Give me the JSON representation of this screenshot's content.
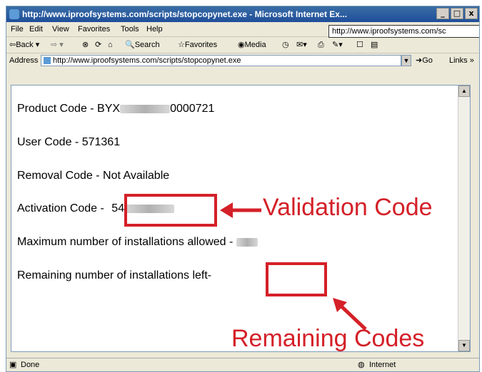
{
  "window": {
    "title": "http://www.iproofsystems.com/scripts/stopcopynet.exe - Microsoft Internet Ex...",
    "minimize": "_",
    "maximize": "□",
    "close": "x"
  },
  "menu": [
    "File",
    "Edit",
    "View",
    "Favorites",
    "Tools",
    "Help"
  ],
  "tooltip_url": "http://www.iproofsystems.com/sc",
  "toolbar": {
    "back": "⇦Back ▾",
    "forward": "⇨ ▾",
    "search": "Search",
    "favorites": "Favorites",
    "media": "Media"
  },
  "address": {
    "label": "Address",
    "url": "http://www.iproofsystems.com/scripts/stopcopynet.exe",
    "go": "Go",
    "links": "Links »"
  },
  "content": {
    "product_code_label": "Product Code - BYX",
    "product_code_suffix": "0000721",
    "user_code": "User Code - 571361",
    "removal_code": "Removal Code - Not Available",
    "activation_label": "Activation Code -",
    "activation_value_prefix": "54",
    "max_installs": "Maximum number of installations allowed -",
    "remaining_installs": "Remaining number of installations left-"
  },
  "annotations": {
    "validation": "Validation Code",
    "remaining": "Remaining Codes",
    "color": "#d42028"
  },
  "status": {
    "text": "Done",
    "zone": "Internet"
  }
}
